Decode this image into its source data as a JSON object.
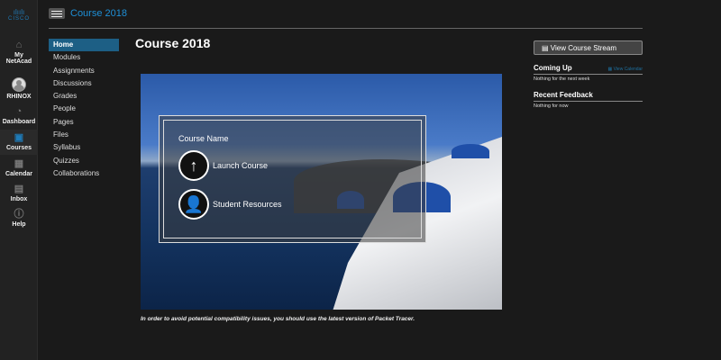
{
  "global_nav": {
    "logo": "cisco",
    "items": [
      {
        "label": "My NetAcad",
        "icon": "home-icon"
      },
      {
        "label": "RHINOX",
        "icon": "avatar"
      },
      {
        "label": "Dashboard",
        "icon": "dashboard-icon"
      },
      {
        "label": "Courses",
        "icon": "courses-icon",
        "active": true
      },
      {
        "label": "Calendar",
        "icon": "calendar-icon"
      },
      {
        "label": "Inbox",
        "icon": "inbox-icon"
      },
      {
        "label": "Help",
        "icon": "help-icon"
      }
    ]
  },
  "breadcrumb": "Course 2018",
  "course_nav": [
    "Home",
    "Modules",
    "Assignments",
    "Discussions",
    "Grades",
    "People",
    "Pages",
    "Files",
    "Syllabus",
    "Quizzes",
    "Collaborations"
  ],
  "title": "Course 2018",
  "hero": {
    "course_name": "Course Name",
    "launch": "Launch Course",
    "resources": "Student Resources"
  },
  "note": "In order to avoid potential compatibility issues, you should use the latest version of Packet Tracer.",
  "sidebar": {
    "stream_button": "View Course Stream",
    "coming_up": "Coming Up",
    "view_calendar": "View Calendar",
    "coming_up_text": "Nothing for the next week",
    "recent_feedback": "Recent Feedback",
    "feedback_text": "Nothing for now"
  }
}
